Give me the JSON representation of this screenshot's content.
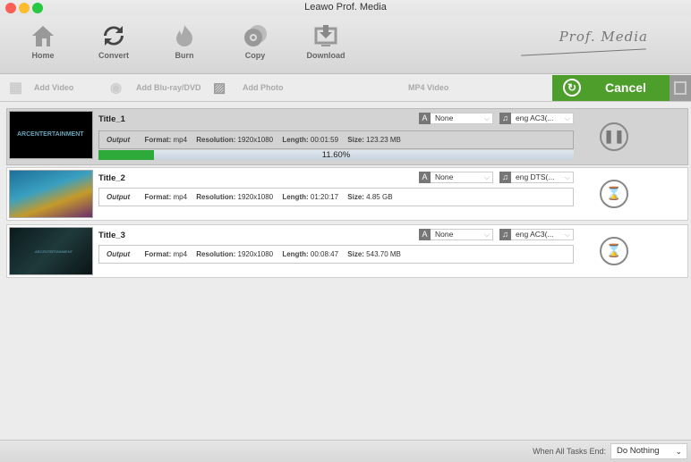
{
  "window": {
    "title": "Leawo Prof. Media"
  },
  "toolbar": {
    "items": [
      {
        "label": "Home",
        "icon": "home-icon"
      },
      {
        "label": "Convert",
        "icon": "convert-icon"
      },
      {
        "label": "Burn",
        "icon": "burn-icon"
      },
      {
        "label": "Copy",
        "icon": "copy-icon"
      },
      {
        "label": "Download",
        "icon": "download-icon"
      }
    ],
    "logo": "Prof. Media"
  },
  "subbar": {
    "add_video": "Add Video",
    "add_bluray": "Add Blu-ray/DVD",
    "add_photo": "Add Photo",
    "profile": "MP4 Video",
    "cancel": "Cancel"
  },
  "labels": {
    "output": "Output",
    "format": "Format:",
    "resolution": "Resolution:",
    "length": "Length:",
    "size": "Size:"
  },
  "tasks": [
    {
      "title": "Title_1",
      "format": "mp4",
      "resolution": "1920x1080",
      "length": "00:01:59",
      "size": "123.23 MB",
      "subtitle": "None",
      "audio": "eng AC3(...",
      "status": "paused-button",
      "progress": 11.6,
      "progress_text": "11.60%"
    },
    {
      "title": "Title_2",
      "format": "mp4",
      "resolution": "1920x1080",
      "length": "01:20:17",
      "size": "4.85 GB",
      "subtitle": "None",
      "audio": "eng DTS(...",
      "status": "waiting"
    },
    {
      "title": "Title_3",
      "format": "mp4",
      "resolution": "1920x1080",
      "length": "00:08:47",
      "size": "543.70 MB",
      "subtitle": "None",
      "audio": "eng AC3(...",
      "status": "waiting"
    }
  ],
  "footer": {
    "label": "When All Tasks End:",
    "option": "Do Nothing"
  },
  "colors": {
    "accent": "#4d9e2b",
    "progress": "#2eaa3b"
  }
}
